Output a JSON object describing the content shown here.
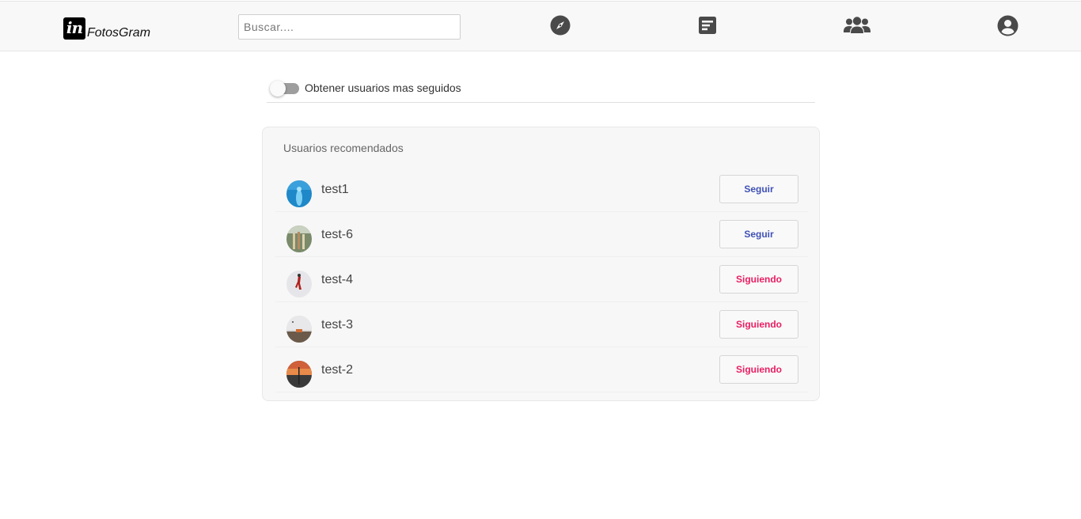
{
  "header": {
    "logo_mark": "in",
    "logo_text": "FotosGram",
    "search_placeholder": "Buscar....",
    "nav_icons": [
      "compass-icon",
      "posts-icon",
      "users-icon",
      "account-icon"
    ]
  },
  "filter": {
    "toggle_label": "Obtener usuarios mas seguidos",
    "toggle_on": false
  },
  "recommended": {
    "title": "Usuarios recomendados",
    "users": [
      {
        "name": "test1",
        "button": "Seguir",
        "following": false
      },
      {
        "name": "test-6",
        "button": "Seguir",
        "following": false
      },
      {
        "name": "test-4",
        "button": "Siguiendo",
        "following": true
      },
      {
        "name": "test-3",
        "button": "Siguiendo",
        "following": true
      },
      {
        "name": "test-2",
        "button": "Siguiendo",
        "following": true
      }
    ]
  },
  "colors": {
    "follow": "#3f51b5",
    "following": "#e91e63",
    "header_bg": "#f8f8f8",
    "icon": "#4a4a4a"
  }
}
